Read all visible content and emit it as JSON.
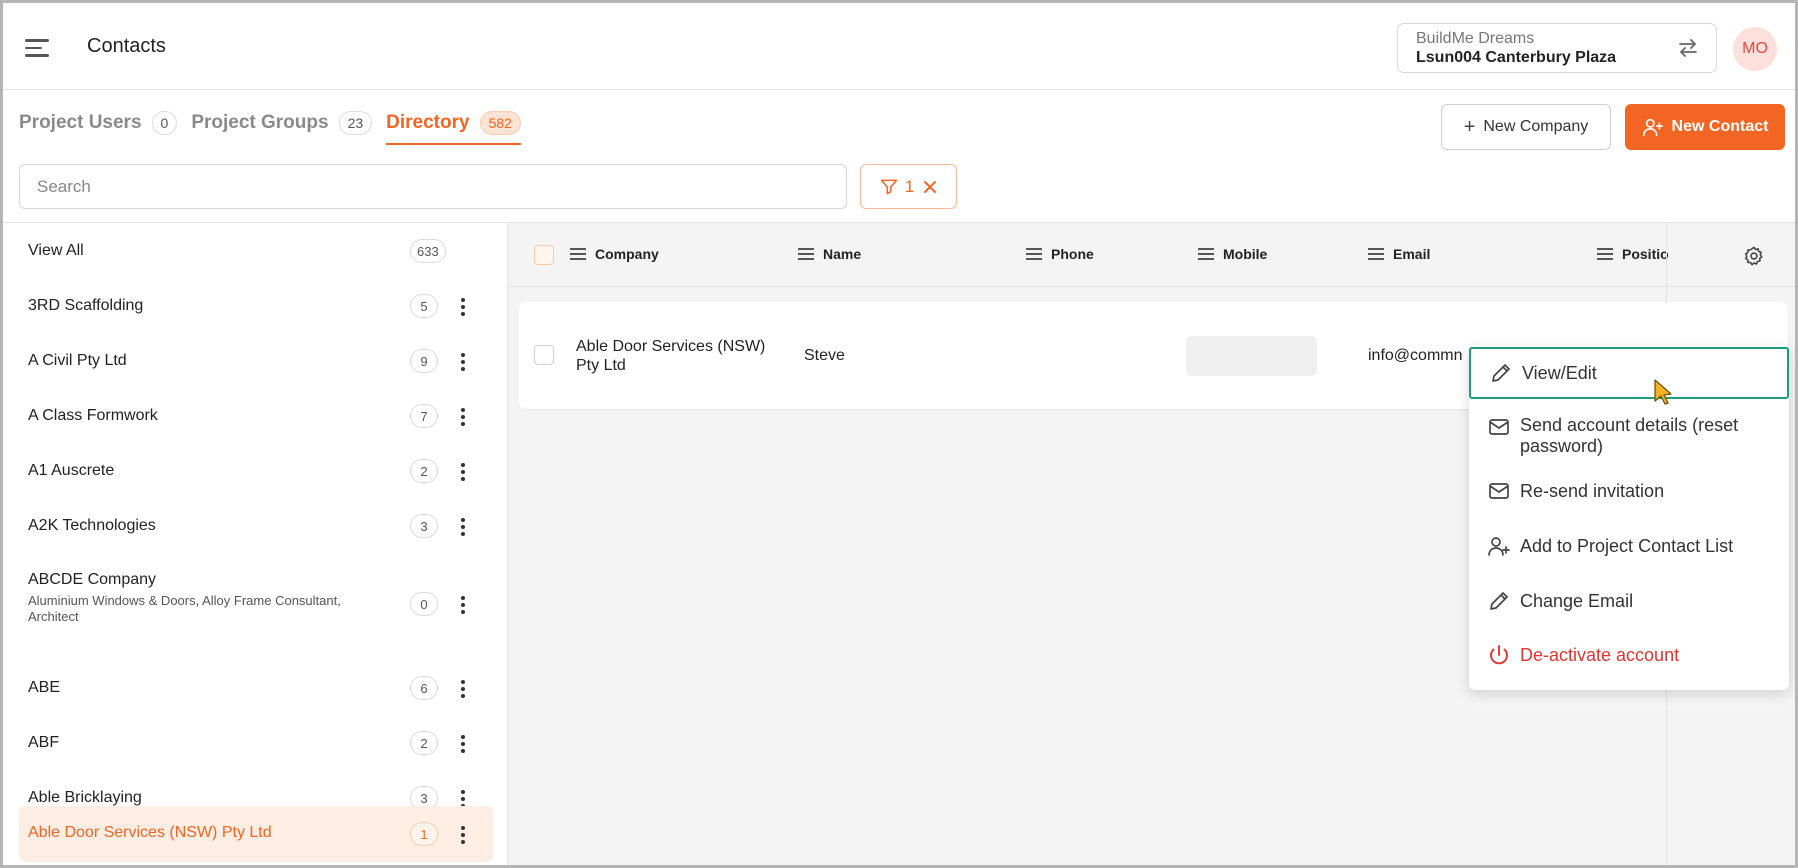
{
  "header": {
    "title": "Contacts",
    "org_name": "BuildMe Dreams",
    "project_name": "Lsun004 Canterbury Plaza",
    "avatar_initials": "MO"
  },
  "tabs": [
    {
      "label": "Project Users",
      "count": "0"
    },
    {
      "label": "Project Groups",
      "count": "23"
    },
    {
      "label": "Directory",
      "count": "582",
      "active": true
    }
  ],
  "actions": {
    "new_company": "New Company",
    "new_contact": "New Contact"
  },
  "search": {
    "placeholder": "Search"
  },
  "filter": {
    "count": "1"
  },
  "sidebar": {
    "items": [
      {
        "name": "View All",
        "count": "633"
      },
      {
        "name": "3RD Scaffolding",
        "count": "5"
      },
      {
        "name": "A Civil Pty Ltd",
        "count": "9"
      },
      {
        "name": "A Class Formwork",
        "count": "7"
      },
      {
        "name": "A1 Auscrete",
        "count": "2"
      },
      {
        "name": "A2K Technologies",
        "count": "3"
      },
      {
        "name": "ABCDE Company",
        "sub": "Aluminium Windows & Doors, Alloy Frame Consultant, Architect",
        "count": "0"
      },
      {
        "name": "ABE",
        "count": "6"
      },
      {
        "name": "ABF",
        "count": "2"
      },
      {
        "name": "Able Bricklaying",
        "count": "3"
      },
      {
        "name": "Able Door Services (NSW) Pty Ltd",
        "count": "1",
        "active": true
      }
    ]
  },
  "table": {
    "columns": [
      "Company",
      "Name",
      "Phone",
      "Mobile",
      "Email",
      "Positio"
    ],
    "rows": [
      {
        "company_line1": "Able Door Services (NSW)",
        "company_line2": "Pty Ltd",
        "name": "Steve",
        "phone": "",
        "email": "info@commn"
      }
    ]
  },
  "context_menu": {
    "items": [
      {
        "label": "View/Edit",
        "icon": "pencil-icon",
        "highlighted": true
      },
      {
        "label": "Send account details (reset password)",
        "icon": "mail-icon"
      },
      {
        "label": "Re-send invitation",
        "icon": "mail-icon"
      },
      {
        "label": "Add to Project Contact List",
        "icon": "user-plus-icon"
      },
      {
        "label": "Change Email",
        "icon": "pencil-icon"
      },
      {
        "label": "De-activate account",
        "icon": "power-icon",
        "danger": true
      }
    ]
  },
  "colors": {
    "accent": "#f26522",
    "highlight_border": "#1e9e78",
    "danger": "#e2342f"
  }
}
